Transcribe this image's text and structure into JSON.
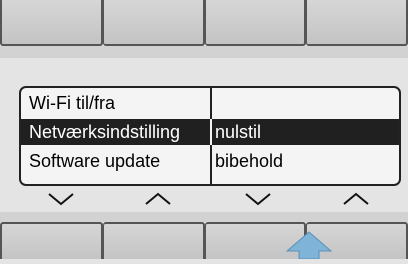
{
  "top_tabs": [
    "",
    "",
    "",
    ""
  ],
  "bottom_tabs": [
    "",
    "",
    "",
    ""
  ],
  "menu": {
    "rows": [
      {
        "label": "Wi-Fi til/fra",
        "value": "",
        "selected": false
      },
      {
        "label": "Netværksindstilling",
        "value": "nulstil",
        "selected": true
      },
      {
        "label": "Software update",
        "value": "bibehold",
        "selected": false
      }
    ]
  },
  "nav_controls": [
    "chevron-down-icon",
    "chevron-up-icon",
    "chevron-down-icon",
    "chevron-up-icon"
  ],
  "colors": {
    "arrow": "#7fb3d8",
    "selected_row": "#202020"
  }
}
